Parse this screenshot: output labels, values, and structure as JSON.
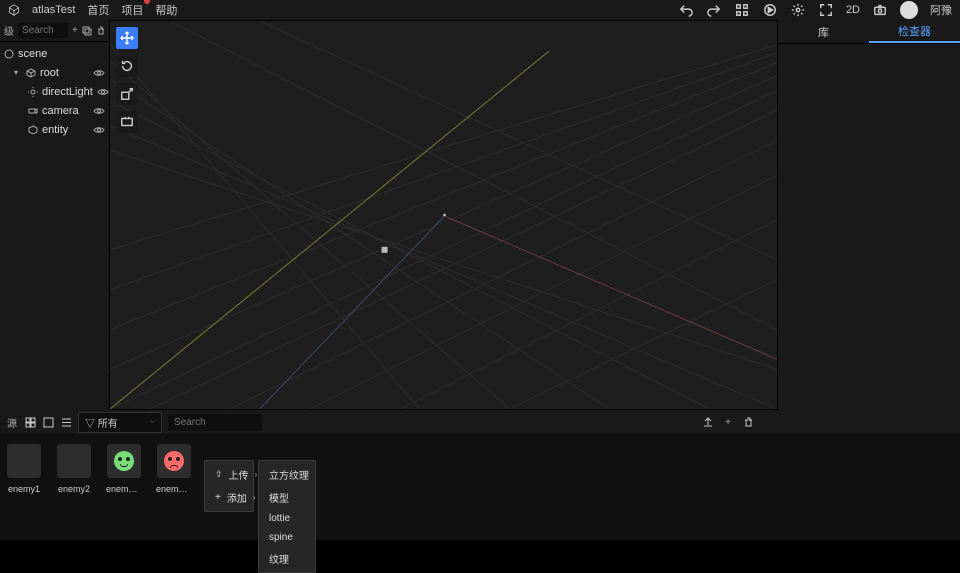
{
  "topbar": {
    "project": "atlasTest",
    "menu": [
      "首页",
      "项目",
      "帮助"
    ],
    "badge_on": 1,
    "mode2d": "2D",
    "username": "阿豫"
  },
  "hierarchy": {
    "search_placeholder": "Search",
    "scene": "scene",
    "root": "root",
    "children": [
      "directLight",
      "camera",
      "entity"
    ]
  },
  "right": {
    "tabs": [
      "库",
      "检查器"
    ],
    "active": 1
  },
  "assets": {
    "filter_prefix": "▽",
    "filter": "所有",
    "search_placeholder": "Search",
    "items": [
      "enemy1",
      "enemy2",
      "enemys…",
      "enemys…"
    ]
  },
  "ctx1": {
    "upload": "上传",
    "add": "添加"
  },
  "ctx2": [
    "立方纹理",
    "模型",
    "lottie",
    "spine",
    "纹理"
  ]
}
